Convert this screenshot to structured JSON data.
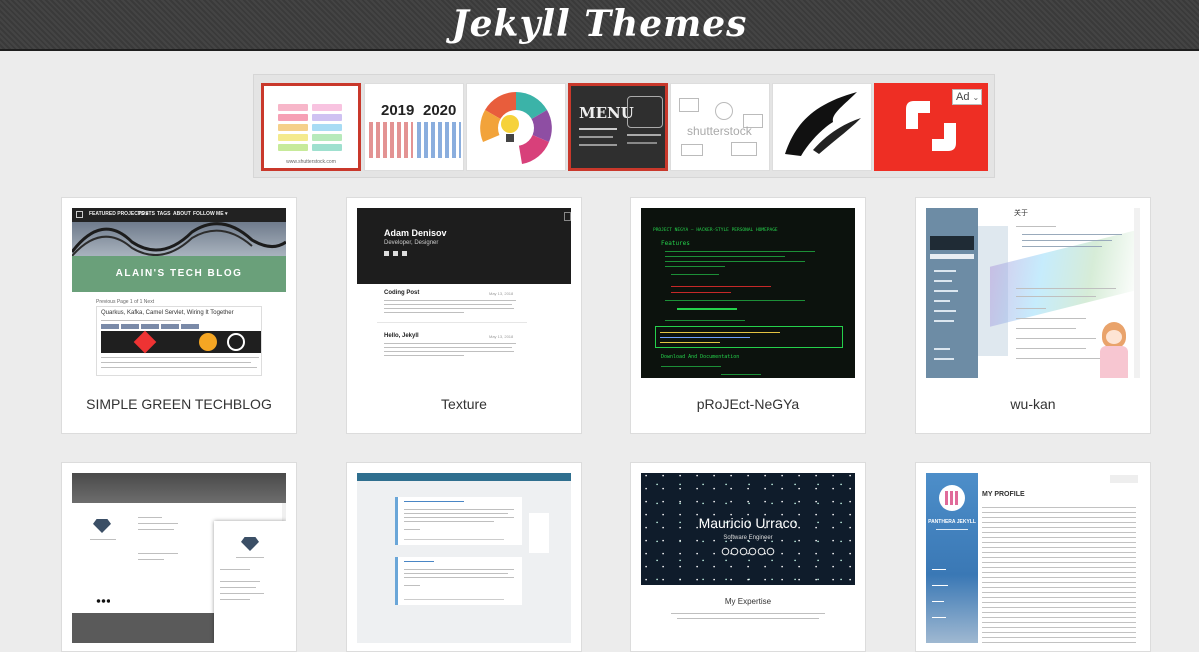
{
  "header": {
    "title": "Jekyll Themes"
  },
  "ad": {
    "badge": "Ad",
    "tile_years": [
      "2019",
      "2020"
    ],
    "tile_menu": "MENU",
    "tile_watermark": "shutterstock"
  },
  "themes": [
    {
      "name": "SIMPLE GREEN TECHBLOG",
      "preview": {
        "nav": [
          "FEATURED PROJECTS ▾",
          "POSTS",
          "TAGS",
          "ABOUT",
          "FOLLOW ME ▾"
        ],
        "banner": "ALAIN'S TECH BLOG",
        "meta": "Previous Page 1 of 1 Next",
        "post_title": "Quarkus, Kafka, Camel Servlet, Wiring It Together"
      }
    },
    {
      "name": "Texture",
      "preview": {
        "author": "Adam Denisov",
        "role": "Developer, Designer",
        "post1": "Coding Post",
        "post2": "Hello, Jekyll",
        "date": "May 13, 2018"
      }
    },
    {
      "name": "pRoJEct-NeGYa",
      "preview": {
        "heading": "PROJECT NEGYA — HACKER-STYLE PERSONAL HOMEPAGE",
        "features": "Features",
        "download": "Download And Documentation"
      }
    },
    {
      "name": "wu-kan",
      "preview": {
        "heading": "关于"
      }
    },
    {
      "name": "",
      "preview": {}
    },
    {
      "name": "",
      "preview": {}
    },
    {
      "name": "",
      "preview": {
        "person": "Mauricio Urraco",
        "role": "Software Engineer",
        "section": "My Expertise"
      }
    },
    {
      "name": "",
      "preview": {
        "brand": "PANTHERA JEKYLL",
        "heading": "MY PROFILE"
      }
    }
  ],
  "colors": {
    "header_bg": "#3a3a3a",
    "ad_frame": "#c9382b",
    "banner_green": "#6aa07a",
    "terminal_green": "#25d04b",
    "shutterstock_red": "#ee2e24"
  }
}
